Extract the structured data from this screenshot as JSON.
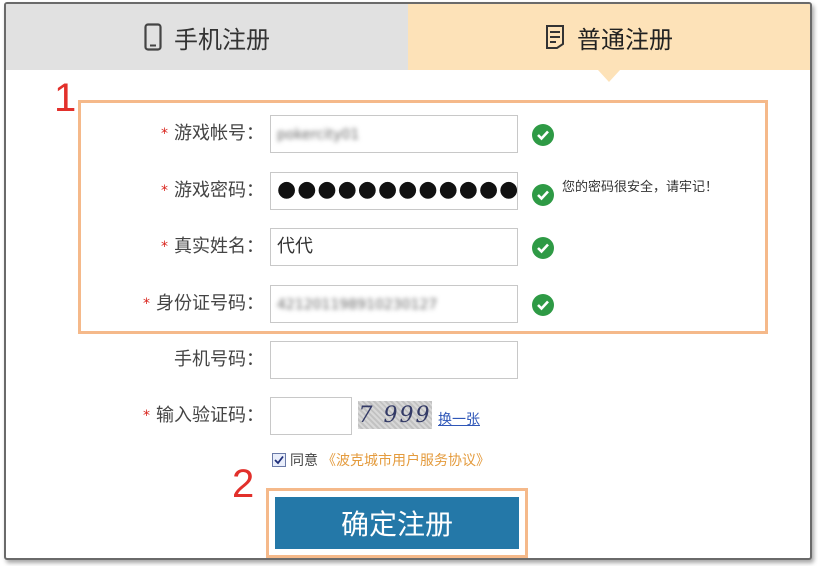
{
  "tabs": {
    "phone_label": "手机注册",
    "normal_label": "普通注册",
    "phone_icon": "mobile-phone-icon",
    "normal_icon": "document-icon"
  },
  "markers": {
    "first": "1",
    "second": "2"
  },
  "form": {
    "required_star": "*",
    "account": {
      "label": "游戏帐号：",
      "value": "pokercity01"
    },
    "password": {
      "label": "游戏密码：",
      "value": "●●●●●●●●●●●●●●●",
      "hint": "您的密码很安全，请牢记！"
    },
    "real_name": {
      "label": "真实姓名：",
      "value": "代代"
    },
    "id_number": {
      "label": "身份证号码：",
      "value": "421201198910230127"
    },
    "phone": {
      "label": "手机号码：",
      "value": ""
    },
    "captcha": {
      "label": "输入验证码：",
      "value": "",
      "image_text": "7 999",
      "refresh_link": "换一张"
    },
    "agree": {
      "text": "同意",
      "link": "《波克城市用户服务协议》",
      "checked": true
    },
    "submit_label": "确定注册"
  },
  "colors": {
    "accent_blue": "#2478a8",
    "highlight_border": "#f5b98a",
    "active_tab": "#fde2b8",
    "inactive_tab": "#e1e1e1",
    "valid_check": "#2e9a45",
    "marker_red": "#e2302b"
  }
}
